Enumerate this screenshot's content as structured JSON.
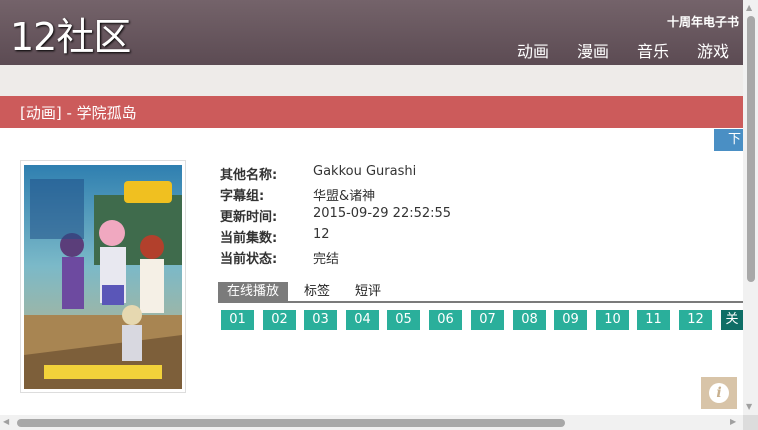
{
  "header": {
    "logo": "12社区",
    "ebook_link": "十周年电子书",
    "nav": [
      "动画",
      "漫画",
      "音乐",
      "游戏"
    ]
  },
  "page": {
    "title": "[动画] - 学院孤岛",
    "download_label": "下"
  },
  "poster": {
    "alt": "学院孤岛 poster"
  },
  "info": {
    "rows": [
      {
        "label": "其他名称:",
        "value": "Gakkou Gurashi"
      },
      {
        "label": "字幕组:",
        "value": "华盟&诸神"
      },
      {
        "label": "更新时间:",
        "value": "2015-09-29 22:52:55"
      },
      {
        "label": "当前集数:",
        "value": "12"
      },
      {
        "label": "当前状态:",
        "value": "完结"
      }
    ]
  },
  "tabs": [
    "在线播放",
    "标签",
    "短评"
  ],
  "episodes": [
    "01",
    "02",
    "03",
    "04",
    "05",
    "06",
    "07",
    "08",
    "09",
    "10",
    "11",
    "12"
  ],
  "close_label": "关",
  "colors": {
    "header": "#6b5a62",
    "title_bar": "#cc5b5b",
    "episode": "#2aaf9b",
    "download": "#4a8fc4"
  },
  "icons": {
    "info_button": "info-icon"
  }
}
